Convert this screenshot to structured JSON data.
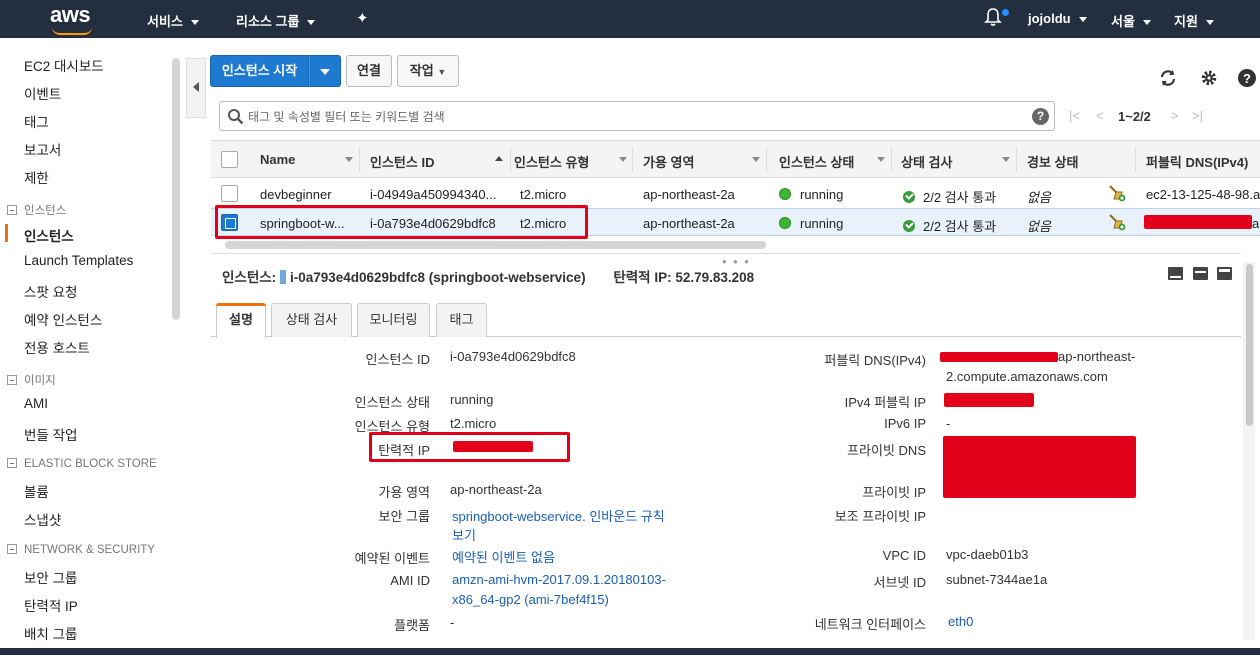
{
  "topbar": {
    "logo": "aws",
    "services": "서비스",
    "resource_groups": "리소스 그룹",
    "user": "jojoldu",
    "region": "서울",
    "support": "지원"
  },
  "sidebar": {
    "items_top": [
      "EC2 대시보드",
      "이벤트",
      "태그",
      "보고서",
      "제한"
    ],
    "section_instances": "인스턴스",
    "instances_items": [
      "인스턴스",
      "Launch Templates",
      "스팟 요청",
      "예약 인스턴스",
      "전용 호스트"
    ],
    "section_images": "이미지",
    "images_items": [
      "AMI",
      "번들 작업"
    ],
    "section_ebs": "ELASTIC BLOCK STORE",
    "ebs_items": [
      "볼륨",
      "스냅샷"
    ],
    "section_network": "NETWORK & SECURITY",
    "network_items": [
      "보안 그룹",
      "탄력적 IP",
      "배치 그룹"
    ]
  },
  "toolbar": {
    "launch": "인스턴스 시작",
    "connect": "연결",
    "actions": "작업"
  },
  "search": {
    "placeholder": "태그 및 속성별 필터 또는 키워드별 검색",
    "help": "?",
    "pager_label": "1~2/2"
  },
  "table": {
    "columns": [
      "Name",
      "인스턴스 ID",
      "인스턴스 유형",
      "가용 영역",
      "인스턴스 상태",
      "상태 검사",
      "경보 상태",
      "퍼블릭 DNS(IPv4)"
    ],
    "rows": [
      {
        "name": "devbeginner",
        "id": "i-04949a450994340...",
        "type": "t2.micro",
        "az": "ap-northeast-2a",
        "state": "running",
        "check": "2/2 검사 통과",
        "alarm": "없음",
        "dns": "ec2-13-125-48-98.a"
      },
      {
        "name": "springboot-w...",
        "id": "i-0a793e4d0629bdfc8",
        "type": "t2.micro",
        "az": "ap-northeast-2a",
        "state": "running",
        "check": "2/2 검사 통과",
        "alarm": "없음",
        "dns": "a"
      }
    ]
  },
  "detail": {
    "title_label": "인스턴스:",
    "title_value": "i-0a793e4d0629bdfc8 (springboot-webservice)",
    "eip_text": "탄력적 IP: 52.79.83.208",
    "tabs": [
      "설명",
      "상태 검사",
      "모니터링",
      "태그"
    ],
    "left": {
      "instance_id_label": "인스턴스 ID",
      "instance_id": "i-0a793e4d0629bdfc8",
      "state_label": "인스턴스 상태",
      "state": "running",
      "type_label": "인스턴스 유형",
      "type": "t2.micro",
      "eip_label": "탄력적 IP",
      "az_label": "가용 영역",
      "az": "ap-northeast-2a",
      "sg_label": "보안 그룹",
      "sg_link": "springboot-webservice",
      "sg_rules_1": "인바운드 규칙",
      "sg_rules_2": "보기",
      "events_label": "예약된 이벤트",
      "events": "예약된 이벤트 없음",
      "ami_label": "AMI ID",
      "ami_1": "amzn-ami-hvm-2017.09.1.20180103-",
      "ami_2": "x86_64-gp2 (ami-7bef4f15)",
      "platform_label": "플랫폼",
      "platform": "-"
    },
    "right": {
      "dns_label": "퍼블릭 DNS(IPv4)",
      "dns_1": "ap-northeast-",
      "dns_2": "2.compute.amazonaws.com",
      "ipv4_label": "IPv4 퍼블릭 IP",
      "ipv6_label": "IPv6 IP",
      "ipv6": "-",
      "private_dns_label": "프라이빗 DNS",
      "private_ip_label": "프라이빗 IP",
      "secondary_ip_label": "보조 프라이빗 IP",
      "vpc_label": "VPC ID",
      "vpc": "vpc-daeb01b3",
      "subnet_label": "서브넷 ID",
      "subnet": "subnet-7344ae1a",
      "eni_label": "네트워크 인터페이스",
      "eni": "eth0"
    }
  },
  "colors": {
    "topbar": "#232f3e",
    "primary": "#1e7ad0",
    "accent": "#ec7211",
    "redaction": "#e3001b",
    "running": "#3eb634"
  }
}
